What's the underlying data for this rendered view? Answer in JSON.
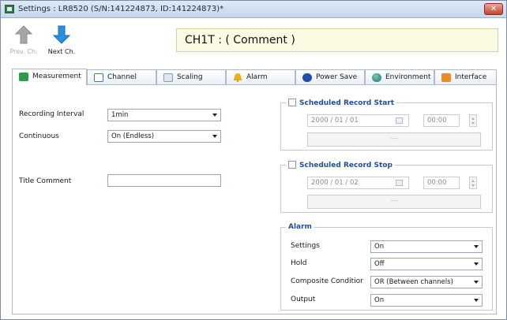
{
  "window": {
    "title": "Settings : LR8520 (S/N:141224873, ID:141224873)*",
    "close_glyph": "✕"
  },
  "toolbar": {
    "prev_label": "Prev. Ch.",
    "next_label": "Next Ch.",
    "channel_title": "CH1T : ( Comment )"
  },
  "tabs": [
    {
      "label": "Measurement",
      "icon": "measurement-icon",
      "active": true
    },
    {
      "label": "Channel",
      "icon": "channel-icon"
    },
    {
      "label": "Scaling",
      "icon": "scaling-icon"
    },
    {
      "label": "Alarm",
      "icon": "alarm-bell-icon"
    },
    {
      "label": "Power Save",
      "icon": "bluetooth-icon"
    },
    {
      "label": "Environment",
      "icon": "globe-icon"
    },
    {
      "label": "Interface",
      "icon": "rss-icon"
    }
  ],
  "measurement": {
    "recording_interval": {
      "label": "Recording Interval",
      "value": "1min"
    },
    "continuous": {
      "label": "Continuous",
      "value": "On (Endless)"
    },
    "title_comment": {
      "label": "Title Comment",
      "value": ""
    }
  },
  "scheduled_start": {
    "title": "Scheduled Record Start",
    "date": "2000 / 01 / 01",
    "time": "00:00",
    "button": "---"
  },
  "scheduled_stop": {
    "title": "Scheduled Record Stop",
    "date": "2000 / 01 / 02",
    "time": "00:00",
    "button": "---"
  },
  "alarm": {
    "title": "Alarm",
    "settings": {
      "label": "Settings",
      "value": "On"
    },
    "hold": {
      "label": "Hold",
      "value": "Off"
    },
    "composite": {
      "label": "Composite Conditior",
      "value": "OR (Between channels)"
    },
    "output": {
      "label": "Output",
      "value": "On"
    }
  },
  "colors": {
    "accent": "#1f4e9a",
    "next_arrow": "#2b8fe0",
    "prev_arrow": "#9a9a9a",
    "comment_bg": "#fbfbe3"
  }
}
